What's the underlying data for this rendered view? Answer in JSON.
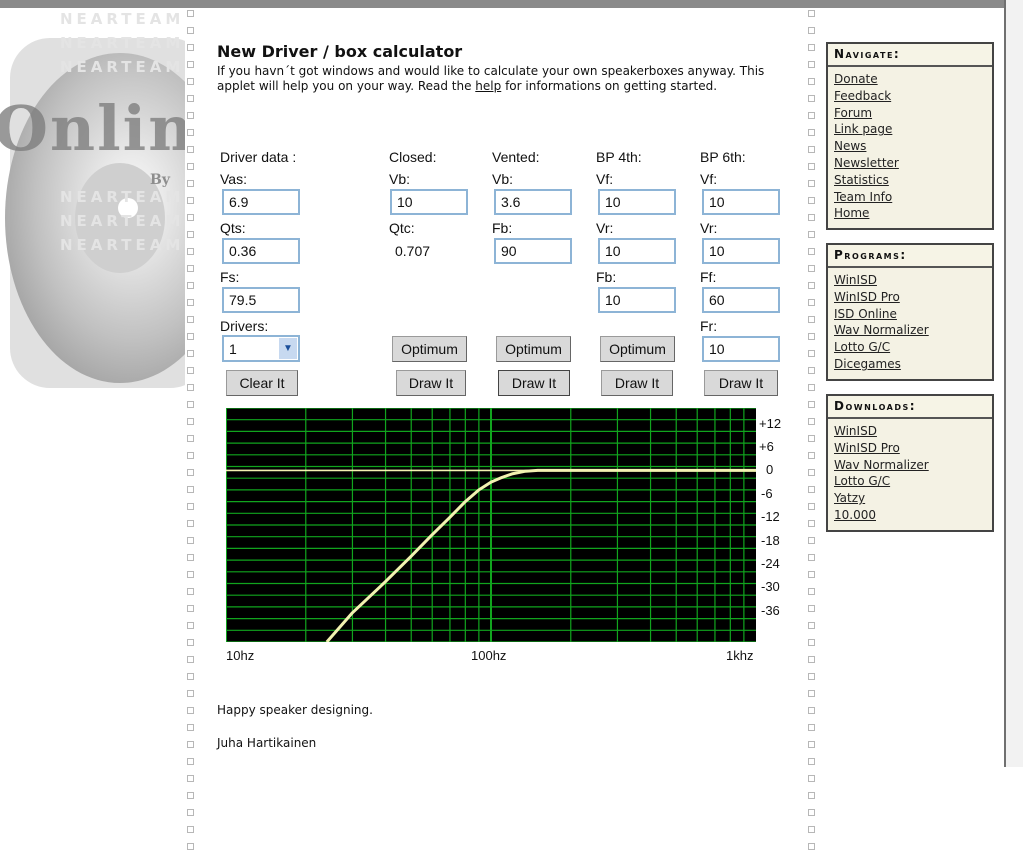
{
  "page": {
    "title": "New Driver / box calculator",
    "intro_before": "If you havn´t got windows and would like to calculate your own speakerboxes anyway. This applet will help you on your way. Read the ",
    "intro_link": "help",
    "intro_after": " for informations on getting started.",
    "logo_text": "Onlin",
    "logo_by": "By",
    "watermark": "NEARTEAM"
  },
  "calculator": {
    "driver": {
      "heading": "Driver data :",
      "vas_label": "Vas:",
      "vas_value": "6.9",
      "qts_label": "Qts:",
      "qts_value": "0.36",
      "fs_label": "Fs:",
      "fs_value": "79.5",
      "drivers_label": "Drivers:",
      "drivers_value": "1",
      "clear_button": "Clear It"
    },
    "closed": {
      "heading": "Closed:",
      "vb_label": "Vb:",
      "vb_value": "10",
      "qtc_label": "Qtc:",
      "qtc_value": "0.707",
      "optimum_button": "Optimum",
      "draw_button": "Draw It"
    },
    "vented": {
      "heading": "Vented:",
      "vb_label": "Vb:",
      "vb_value": "3.6",
      "fb_label": "Fb:",
      "fb_value": "90",
      "optimum_button": "Optimum",
      "draw_button": "Draw It"
    },
    "bp4": {
      "heading": "BP 4th:",
      "vf_label": "Vf:",
      "vf_value": "10",
      "vr_label": "Vr:",
      "vr_value": "10",
      "fb_label": "Fb:",
      "fb_value": "10",
      "optimum_button": "Optimum",
      "draw_button": "Draw It"
    },
    "bp6": {
      "heading": "BP 6th:",
      "vf_label": "Vf:",
      "vf_value": "10",
      "vr_label": "Vr:",
      "vr_value": "10",
      "ff_label": "Ff:",
      "ff_value": "60",
      "fr_label": "Fr:",
      "fr_value": "10",
      "draw_button": "Draw It"
    }
  },
  "chart_data": {
    "type": "line",
    "title": "",
    "xlabel": "",
    "ylabel": "",
    "x_scale": "log",
    "xlim": [
      10,
      1000
    ],
    "ylim": [
      -44,
      16
    ],
    "x_tick_labels": [
      "10hz",
      "100hz",
      "1khz"
    ],
    "y_tick_labels": [
      "+12",
      "+6",
      "0",
      "-6",
      "-12",
      "-18",
      "-24",
      "-30",
      "-36"
    ],
    "y_ticks": [
      12,
      6,
      0,
      -6,
      -12,
      -18,
      -24,
      -30,
      -36
    ],
    "grid": true,
    "background": "#000000",
    "grid_color": "#11a51e",
    "line_color": "#f2f2b0",
    "series": [
      {
        "x": [
          24,
          30,
          40,
          50,
          60,
          70,
          80,
          90,
          100,
          110,
          120,
          135,
          150,
          300,
          1000
        ],
        "y": [
          -44,
          -36.5,
          -28.5,
          -22,
          -16.5,
          -12,
          -8,
          -5,
          -3,
          -1.8,
          -0.9,
          -0.2,
          0,
          0,
          0
        ]
      }
    ]
  },
  "sidebar": {
    "navigate": {
      "title": "Navigate:",
      "items": [
        "Donate",
        "Feedback",
        "Forum",
        "Link page",
        "News",
        "Newsletter",
        "Statistics",
        "Team Info",
        "Home"
      ]
    },
    "programs": {
      "title": "Programs:",
      "items": [
        "WinISD",
        "WinISD Pro",
        "ISD Online",
        "Wav Normalizer",
        "Lotto G/C",
        "Dicegames"
      ]
    },
    "downloads": {
      "title": "Downloads:",
      "items": [
        "WinISD",
        "WinISD Pro",
        "Wav Normalizer",
        "Lotto G/C",
        "Yatzy",
        "10.000"
      ]
    }
  },
  "footer": {
    "line1": "Happy speaker designing.",
    "line2": "Juha Hartikainen"
  }
}
